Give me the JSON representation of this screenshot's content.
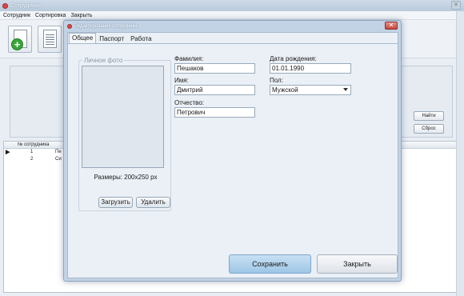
{
  "main": {
    "title": "Сотрудники",
    "menu": [
      "Сотрудник",
      "Сортировка",
      "Закрыть"
    ],
    "side_buttons": {
      "find": "Найти",
      "reset": "Сброс"
    },
    "grid": {
      "column": "№ сотрудника",
      "rows": [
        {
          "marker": "▶",
          "num": "1",
          "cut": "Пе"
        },
        {
          "marker": "",
          "num": "2",
          "cut": "Си"
        }
      ]
    }
  },
  "dialog": {
    "title": "Редактирование сотрудника",
    "close_glyph": "✕",
    "tabs": [
      "Общее",
      "Паспорт",
      "Работа"
    ],
    "photo": {
      "legend": "Личное фото",
      "size_text": "Размеры: 200x250 px",
      "load_label": "Загрузить",
      "delete_label": "Удалить"
    },
    "fields": {
      "surname": {
        "label": "Фамилия:",
        "value": "Пешаков"
      },
      "name": {
        "label": "Имя:",
        "value": "Дмитрий"
      },
      "patronymic": {
        "label": "Отчество:",
        "value": "Петрович"
      },
      "birthdate": {
        "label": "Дата рождения:",
        "value": "01.01.1990"
      },
      "gender": {
        "label": "Пол:",
        "value": "Мужской"
      }
    },
    "save_label": "Сохранить",
    "close_label": "Закрыть"
  }
}
